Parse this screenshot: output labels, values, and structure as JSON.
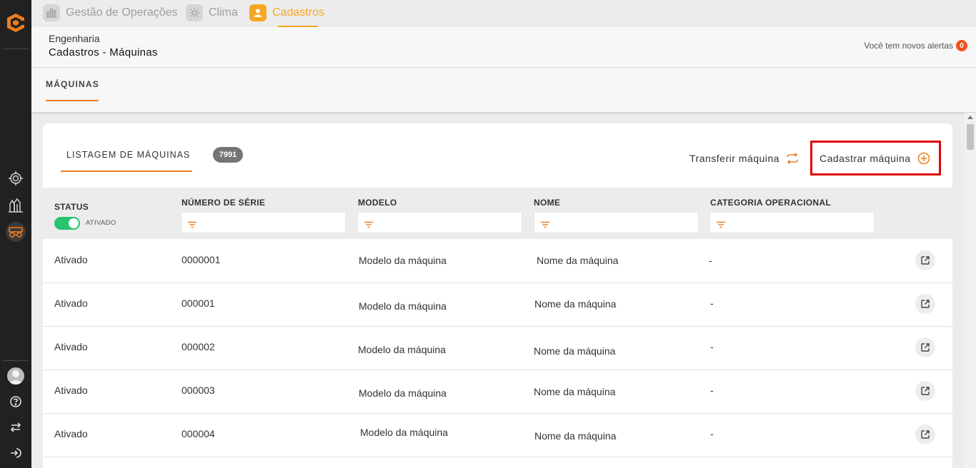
{
  "top_tabs": [
    {
      "label": "Gestão de Operações",
      "icon": "chart-icon"
    },
    {
      "label": "Clima",
      "icon": "sun-icon"
    },
    {
      "label": "Cadastros",
      "icon": "user-icon"
    }
  ],
  "header": {
    "breadcrumb_parent": "Engenharia",
    "breadcrumb_current": "Cadastros - Máquinas",
    "alerts_text": "Você tem novos alertas",
    "alerts_count": "0"
  },
  "section_tab": "MÁQUINAS",
  "listing": {
    "tab_label": "LISTAGEM DE MÁQUINAS",
    "count": "7991",
    "transfer_label": "Transferir máquina",
    "register_label": "Cadastrar máquina"
  },
  "table": {
    "columns": {
      "status": "STATUS",
      "serial": "NÚMERO DE SÉRIE",
      "model": "MODELO",
      "name": "NOME",
      "category": "CATEGORIA OPERACIONAL"
    },
    "status_filter_label": "ATIVADO",
    "rows": [
      {
        "status": "Ativado",
        "serial": "0000001",
        "model": "Modelo da máquina",
        "name": "Nome da máquina",
        "category": "-"
      },
      {
        "status": "Ativado",
        "serial": "000001",
        "model": "Modelo da máquina",
        "name": "Nome da máquina",
        "category": "-"
      },
      {
        "status": "Ativado",
        "serial": "000002",
        "model": "Modelo da máquina",
        "name": "Nome da máquina",
        "category": "-"
      },
      {
        "status": "Ativado",
        "serial": "000003",
        "model": "Modelo da máquina",
        "name": "Nome da máquina",
        "category": "-"
      },
      {
        "status": "Ativado",
        "serial": "000004",
        "model": "Modelo da máquina",
        "name": "Nome da máquina",
        "category": "-"
      }
    ]
  },
  "colors": {
    "accent_orange": "#f07c1e",
    "active_tab": "#f5a623",
    "toggle_green": "#27c46e",
    "alert_red": "#f4511e",
    "highlight_red": "#e00000"
  }
}
